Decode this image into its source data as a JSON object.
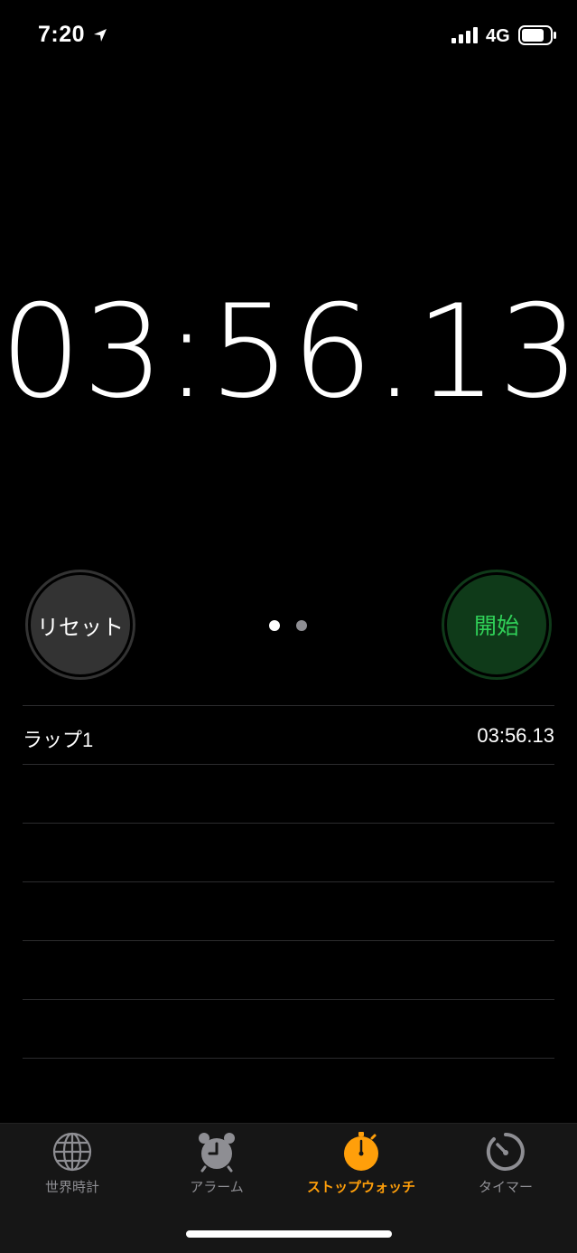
{
  "status_bar": {
    "time": "7:20",
    "network": "4G",
    "icons": [
      "location-arrow-icon",
      "signal-bars-icon",
      "battery-icon"
    ]
  },
  "stopwatch": {
    "time": "03:56.13",
    "reset_label": "リセット",
    "start_label": "開始",
    "page_count": 2,
    "active_page": 1
  },
  "laps": [
    {
      "label": "ラップ1",
      "time": "03:56.13"
    }
  ],
  "tab_bar": {
    "tabs": [
      {
        "label": "世界時計",
        "icon": "globe-icon",
        "active": false
      },
      {
        "label": "アラーム",
        "icon": "alarm-clock-icon",
        "active": false
      },
      {
        "label": "ストップウォッチ",
        "icon": "stopwatch-icon",
        "active": true
      },
      {
        "label": "タイマー",
        "icon": "timer-icon",
        "active": false
      }
    ]
  },
  "colors": {
    "background": "#000000",
    "accent": "#ff9f0a",
    "start_green": "#30d158",
    "start_bg": "#0f3a19",
    "reset_bg": "#333333",
    "inactive_tab": "#8e8e93"
  }
}
